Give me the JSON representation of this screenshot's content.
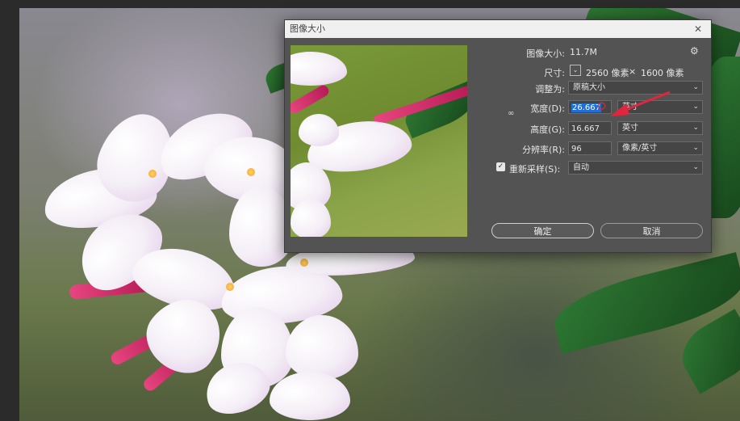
{
  "dialog": {
    "title": "图像大小",
    "close_icon": "close-icon",
    "image_size_label": "图像大小:",
    "image_size_value": "11.7M",
    "dimensions_label": "尺寸:",
    "dimensions_width": "2560 像素",
    "dimensions_times": "×",
    "dimensions_height": "1600 像素",
    "fit_to_label": "调整为:",
    "fit_to_value": "原稿大小",
    "width_label": "宽度(D):",
    "width_value": "26.667",
    "width_unit": "英寸",
    "height_label": "高度(G):",
    "height_value": "16.667",
    "height_unit": "英寸",
    "resolution_label": "分辨率(R):",
    "resolution_value": "96",
    "resolution_unit": "像素/英寸",
    "resample_label": "重新采样(S):",
    "resample_checked": true,
    "resample_value": "自动",
    "ok_label": "确定",
    "cancel_label": "取消"
  },
  "colors": {
    "dialog_bg": "#535353",
    "highlight": "#1f6fd6",
    "arrow": "#e0263c"
  }
}
